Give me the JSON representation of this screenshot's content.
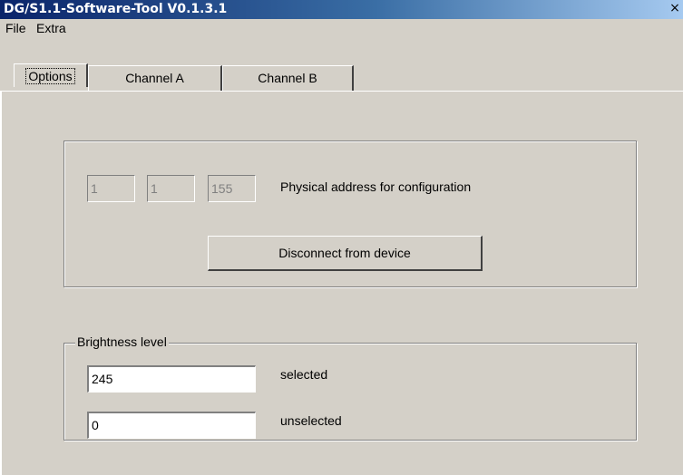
{
  "window": {
    "title": "DG/S1.1-Software-Tool V0.1.3.1",
    "close_glyph": "×"
  },
  "menu": {
    "items": [
      "File",
      "Extra"
    ]
  },
  "tabs": [
    {
      "label": "Options",
      "active": true
    },
    {
      "label": "Channel A",
      "active": false
    },
    {
      "label": "Channel B",
      "active": false
    }
  ],
  "options": {
    "address": {
      "fields": [
        "1",
        "1",
        "155"
      ],
      "label": "Physical address for configuration"
    },
    "disconnect_button": "Disconnect from device",
    "brightness": {
      "title": "Brightness level",
      "selected_value": "245",
      "selected_label": "selected",
      "unselected_value": "0",
      "unselected_label": "unselected"
    }
  }
}
